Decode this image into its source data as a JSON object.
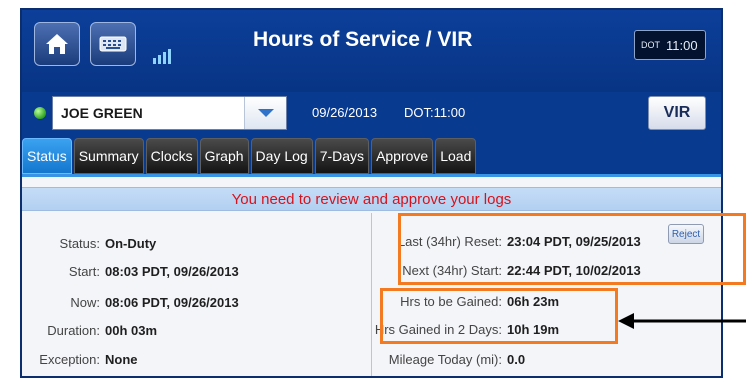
{
  "header": {
    "title": "Hours of Service / VIR",
    "dot_box_label": "DOT",
    "dot_box_time": "11:00"
  },
  "driver": {
    "name": "JOE GREEN",
    "date": "09/26/2013",
    "dot_time": "DOT:11:00"
  },
  "vir_button": "VIR",
  "tabs": [
    "Status",
    "Summary",
    "Clocks",
    "Graph",
    "Day Log",
    "7-Days",
    "Approve",
    "Load"
  ],
  "active_tab": "Status",
  "alert": "You need to review and approve your logs",
  "left": {
    "status_label": "Status:",
    "status_value": "On-Duty",
    "start_label": "Start:",
    "start_value": "08:03 PDT, 09/26/2013",
    "now_label": "Now:",
    "now_value": "08:06 PDT, 09/26/2013",
    "duration_label": "Duration:",
    "duration_value": "00h 03m",
    "exception_label": "Exception:",
    "exception_value": "None"
  },
  "right": {
    "last_reset_label": "Last (34hr) Reset:",
    "last_reset_value": "23:04 PDT, 09/25/2013",
    "reject_label": "Reject",
    "next_start_label": "Next (34hr) Start:",
    "next_start_value": "22:44 PDT, 10/02/2013",
    "hrs_gain_label": "Hrs to be Gained:",
    "hrs_gain_value": "06h 23m",
    "hrs_gained_label": "Hrs Gained in 2 Days:",
    "hrs_gained_value": "10h 19m",
    "mileage_label": "Mileage Today (mi):",
    "mileage_value": "0.0"
  },
  "icons": {
    "home": "home-icon",
    "keyboard": "keyboard-icon",
    "signal": "signal-icon",
    "dropdown": "chevron-down-icon"
  },
  "colors": {
    "background": "#083a8f",
    "active_tab": "#1f86dd",
    "alert_text": "#d8121b",
    "highlight": "#f37a20",
    "status_dot": "#2fa31f"
  }
}
